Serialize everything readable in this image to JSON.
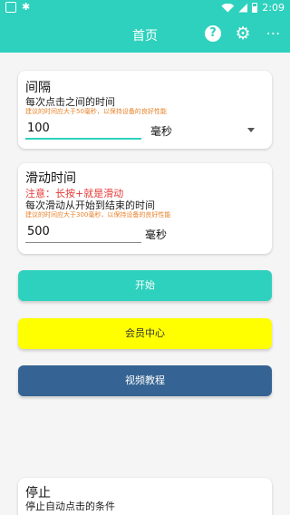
{
  "status_bar": {
    "time": "2:09"
  },
  "app_bar": {
    "title": "首页"
  },
  "interval_card": {
    "title": "间隔",
    "desc": "每次点击之间的时间",
    "hint": "建议的时间应大于50毫秒，以保持设备的良好性能",
    "value": "100",
    "unit": "毫秒"
  },
  "swipe_card": {
    "title": "滑动时间",
    "warning": "注意：长按+就是滑动",
    "desc": "每次滑动从开始到结束的时间",
    "hint": "建议的时间应大于300毫秒，以保持设备的良好性能",
    "value": "500",
    "unit": "毫秒"
  },
  "buttons": {
    "start": "开始",
    "vip": "会员中心",
    "video": "视频教程"
  },
  "stop_card": {
    "title": "停止",
    "desc": "停止自动点击的条件"
  },
  "colors": {
    "accent": "#2ed1bd",
    "vip": "#ffff00",
    "video": "#356393",
    "warning": "#e53935",
    "hint": "#e8822a"
  }
}
